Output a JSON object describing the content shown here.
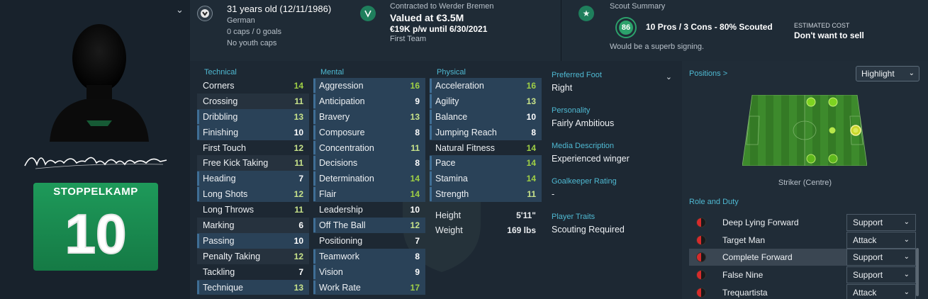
{
  "player": {
    "signature_name": "Moritz Stoppelkamp",
    "shirt_name": "STOPPELKAMP",
    "shirt_number": "10"
  },
  "topbar": {
    "personal": {
      "age_dob": "31 years old (12/11/1986)",
      "nationality": "German",
      "caps": "0 caps / 0 goals",
      "youth_caps": "No youth caps"
    },
    "contract": {
      "club_line": "Contracted to Werder Bremen",
      "value": "Valued at €3.5M",
      "wage": "€19K p/w until 6/30/2021",
      "squad_status": "First Team"
    },
    "scout": {
      "title": "Scout Summary",
      "rating": "86",
      "summary": "10 Pros / 3 Cons - 80% Scouted",
      "verdict": "Would be a superb signing.",
      "cost_label": "ESTIMATED COST",
      "cost_value": "Don't want to sell"
    }
  },
  "technical": {
    "title": "Technical",
    "rows": [
      {
        "label": "Corners",
        "value": "14"
      },
      {
        "label": "Crossing",
        "value": "11"
      },
      {
        "label": "Dribbling",
        "value": "13"
      },
      {
        "label": "Finishing",
        "value": "10"
      },
      {
        "label": "First Touch",
        "value": "12"
      },
      {
        "label": "Free Kick Taking",
        "value": "11"
      },
      {
        "label": "Heading",
        "value": "7"
      },
      {
        "label": "Long Shots",
        "value": "12"
      },
      {
        "label": "Long Throws",
        "value": "11"
      },
      {
        "label": "Marking",
        "value": "6"
      },
      {
        "label": "Passing",
        "value": "10"
      },
      {
        "label": "Penalty Taking",
        "value": "12"
      },
      {
        "label": "Tackling",
        "value": "7"
      },
      {
        "label": "Technique",
        "value": "13"
      }
    ]
  },
  "mental": {
    "title": "Mental",
    "rows": [
      {
        "label": "Aggression",
        "value": "16"
      },
      {
        "label": "Anticipation",
        "value": "9"
      },
      {
        "label": "Bravery",
        "value": "13"
      },
      {
        "label": "Composure",
        "value": "8"
      },
      {
        "label": "Concentration",
        "value": "11"
      },
      {
        "label": "Decisions",
        "value": "8"
      },
      {
        "label": "Determination",
        "value": "14"
      },
      {
        "label": "Flair",
        "value": "14"
      },
      {
        "label": "Leadership",
        "value": "10"
      },
      {
        "label": "Off The Ball",
        "value": "12"
      },
      {
        "label": "Positioning",
        "value": "7"
      },
      {
        "label": "Teamwork",
        "value": "8"
      },
      {
        "label": "Vision",
        "value": "9"
      },
      {
        "label": "Work Rate",
        "value": "17"
      }
    ]
  },
  "physical": {
    "title": "Physical",
    "rows": [
      {
        "label": "Acceleration",
        "value": "16"
      },
      {
        "label": "Agility",
        "value": "13"
      },
      {
        "label": "Balance",
        "value": "10"
      },
      {
        "label": "Jumping Reach",
        "value": "8"
      },
      {
        "label": "Natural Fitness",
        "value": "14"
      },
      {
        "label": "Pace",
        "value": "14"
      },
      {
        "label": "Stamina",
        "value": "14"
      },
      {
        "label": "Strength",
        "value": "11"
      }
    ],
    "height_label": "Height",
    "height_value": "5'11\"",
    "weight_label": "Weight",
    "weight_value": "169 lbs"
  },
  "info": {
    "foot_label": "Preferred Foot",
    "foot_value": "Right",
    "personality_label": "Personality",
    "personality_value": "Fairly Ambitious",
    "media_label": "Media Description",
    "media_value": "Experienced winger",
    "gk_label": "Goalkeeper Rating",
    "gk_value": "-",
    "traits_label": "Player Traits",
    "traits_value": "Scouting Required"
  },
  "positions": {
    "title": "Positions >",
    "highlight_button": "Highlight",
    "selected_position": "Striker (Centre)",
    "role_title": "Role and Duty",
    "roles": [
      {
        "name": "Deep Lying Forward",
        "duty": "Support"
      },
      {
        "name": "Target Man",
        "duty": "Attack"
      },
      {
        "name": "Complete Forward",
        "duty": "Support"
      },
      {
        "name": "False Nine",
        "duty": "Support"
      },
      {
        "name": "Trequartista",
        "duty": "Attack"
      }
    ]
  },
  "colors": {
    "accent": "#4fb9d2",
    "rating_green": "#9fcf45",
    "shirt_green": "#1e9a5a"
  }
}
